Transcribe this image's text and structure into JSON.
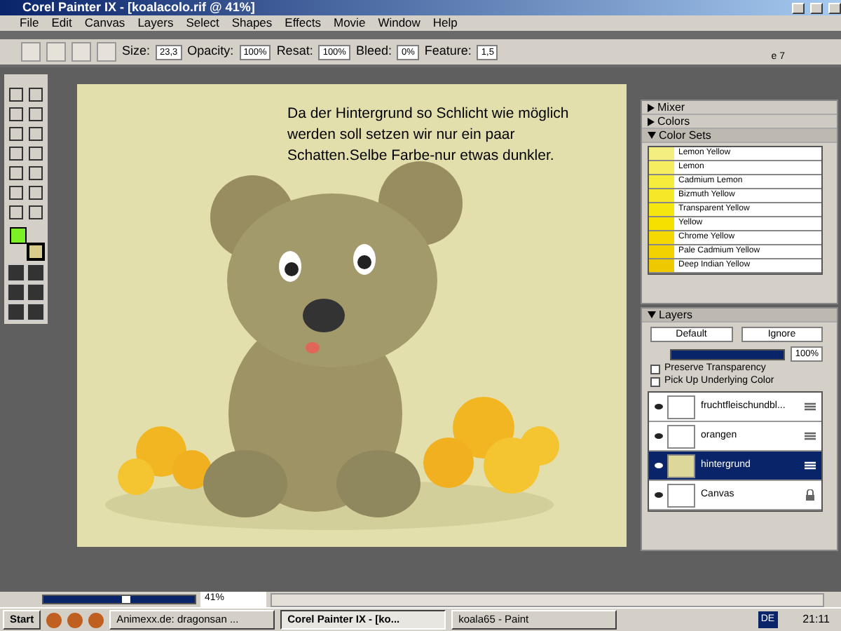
{
  "window": {
    "title": "Corel Painter IX - [koalacolo.rif @ 41%]"
  },
  "menu": [
    "File",
    "Edit",
    "Canvas",
    "Layers",
    "Select",
    "Shapes",
    "Effects",
    "Movie",
    "Window",
    "Help"
  ],
  "toolbar": {
    "fields": [
      {
        "label": "Size:",
        "value": "23,3"
      },
      {
        "label": "Opacity:",
        "value": "100%"
      },
      {
        "label": "Resat:",
        "value": "100%"
      },
      {
        "label": "Bleed:",
        "value": "0%"
      },
      {
        "label": "Feature:",
        "value": "1,5"
      }
    ],
    "hidden_text": "e 7"
  },
  "color_swatches": [
    {
      "kind": "main",
      "color": "#7cf026"
    },
    {
      "kind": "additional",
      "color": "#d8cc8c"
    }
  ],
  "canvas": {
    "lines": [
      "Da der Hintergrund so Schlicht wie möglich",
      "werden soll setzen wir nur ein paar",
      "Schatten.Selbe Farbe-nur etwas dunkler."
    ]
  },
  "palettes": [
    {
      "title": "Mixer",
      "expanded": false
    },
    {
      "title": "Colors",
      "expanded": false
    },
    {
      "title": "Color Sets",
      "expanded": true
    }
  ],
  "color_set": [
    {
      "name": "Lemon Yellow",
      "color": "#f4ee80"
    },
    {
      "name": "Lemon",
      "color": "#f6ee60"
    },
    {
      "name": "Cadmium Lemon",
      "color": "#f6ec3c"
    },
    {
      "name": "Bizmuth Yellow",
      "color": "#f4e828"
    },
    {
      "name": "Transparent Yellow",
      "color": "#f6e610"
    },
    {
      "name": "Yellow",
      "color": "#f6e000"
    },
    {
      "name": "Chrome Yellow",
      "color": "#f4d800"
    },
    {
      "name": "Pale Cadmium Yellow",
      "color": "#f2d200"
    },
    {
      "name": "Deep Indian Yellow",
      "color": "#eec800"
    }
  ],
  "layers_panel": {
    "title": "Layers",
    "composite_method": "Default",
    "depth": "Ignore",
    "opacity": "100%",
    "level": 1,
    "options": [
      {
        "label": "Preserve Transparency",
        "checked": false
      },
      {
        "label": "Pick Up Underlying Color",
        "checked": false
      }
    ],
    "layers": [
      {
        "name": "fruchtfleischundbl...",
        "selected": false,
        "kind": "layer"
      },
      {
        "name": "orangen",
        "selected": false,
        "kind": "layer"
      },
      {
        "name": "hintergrund",
        "selected": true,
        "kind": "layer"
      },
      {
        "name": "Canvas",
        "selected": false,
        "kind": "canvas"
      }
    ]
  },
  "status": {
    "zoom": "41%",
    "level": 0.55
  },
  "taskbar": {
    "start": "Start",
    "tasks": [
      {
        "label": "Animexx.de: dragonsan ...",
        "selected": false
      },
      {
        "label": "Corel Painter IX - [ko...",
        "selected": true
      },
      {
        "label": "koala65 - Paint",
        "selected": false
      }
    ],
    "language": "DE",
    "clock": "21:11"
  }
}
